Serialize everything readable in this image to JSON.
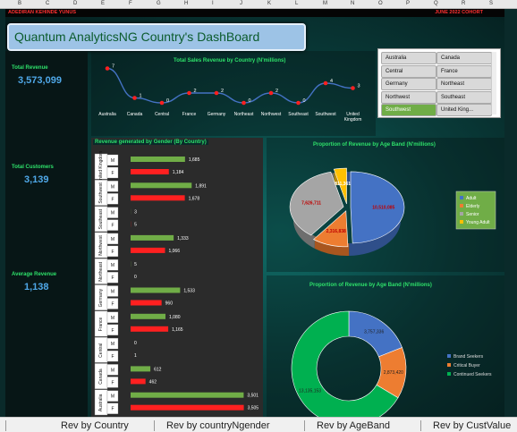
{
  "column_headers": [
    "B",
    "C",
    "D",
    "E",
    "F",
    "G",
    "H",
    "I",
    "J",
    "K",
    "L",
    "M",
    "N",
    "O",
    "P",
    "Q",
    "R",
    "S"
  ],
  "header": {
    "author": "ADEDIRAN KEHINDE YUNUS",
    "date": "JUNE 2022 COHORT"
  },
  "title": "Quantum AnalyticsNG Country's DashBoard",
  "kpis": [
    {
      "label": "Total Revenue",
      "value": "3,573,099"
    },
    {
      "label": "Total Customers",
      "value": "3,139"
    },
    {
      "label": "Average Revenue",
      "value": "1,138"
    }
  ],
  "slicer": {
    "items": [
      "Australia",
      "Canada",
      "Central",
      "France",
      "Germany",
      "Northeast",
      "Northwest",
      "Southeast",
      "Southwest",
      "United King..."
    ],
    "selected": "Southwest"
  },
  "tabs": [
    "Rev by Country",
    "Rev by countryNgender",
    "Rev by AgeBand",
    "Rev by CustValue"
  ],
  "colors": {
    "green": "#2ee06a",
    "red": "#ff2020",
    "blue": "#4472c4",
    "orange": "#ed7d31",
    "grey": "#a5a5a5",
    "yellow": "#ffc000",
    "series_green": "#70ad47"
  },
  "chart_data": [
    {
      "type": "line",
      "title": "Total Sales Revenue by Country (N'millions)",
      "categories": [
        "Australia",
        "Canada",
        "Central",
        "France",
        "Germany",
        "Northeast",
        "Northwest",
        "Southeast",
        "Southwest",
        "United Kingdom"
      ],
      "values": [
        7,
        1,
        0,
        2,
        2,
        0,
        2,
        0,
        4,
        3
      ]
    },
    {
      "type": "bar",
      "title": "Revenue generated by Gender (By Country)",
      "categories": [
        "United Kingdom",
        "Southwest",
        "Southeast",
        "Northwest",
        "Northeast",
        "Germany",
        "France",
        "Central",
        "Canada",
        "Australia"
      ],
      "series": [
        {
          "name": "M",
          "values": [
            1685,
            1891,
            3,
            1333,
            5,
            1533,
            1080,
            0,
            612,
            3501
          ]
        },
        {
          "name": "F",
          "values": [
            1184,
            1678,
            5,
            1066,
            0,
            960,
            1165,
            1,
            462,
            3505
          ]
        }
      ],
      "value_labels": {
        "M": [
          "1,685",
          "1,891",
          "3",
          "1,333",
          "5",
          "1,533",
          "1,080",
          "0",
          "612",
          "3,501"
        ],
        "F": [
          "1,184",
          "1,678",
          "5",
          "1,066",
          "0",
          "960",
          "1,165",
          "1",
          "462",
          "3,505"
        ]
      }
    },
    {
      "type": "pie",
      "title": "Proportion of Revenue by Age Band (N'millions)",
      "legend": [
        "Adult",
        "Elderly",
        "Senior",
        "Young Adult"
      ],
      "values": [
        10510085,
        2316838,
        7626711,
        811361
      ],
      "labels": [
        "10,510,085",
        "2,316,838",
        "7,626,711",
        "811,361"
      ]
    },
    {
      "type": "pie",
      "title": "Proportion of Revenue by Age Band (N'millions)",
      "legend": [
        "Brand Seekers",
        "Critical Buyer",
        "Continued Seekers"
      ],
      "values": [
        3757336,
        2873420,
        13135153
      ],
      "labels": [
        "3,757,336",
        "2,873,420",
        "13,135,153"
      ]
    }
  ]
}
